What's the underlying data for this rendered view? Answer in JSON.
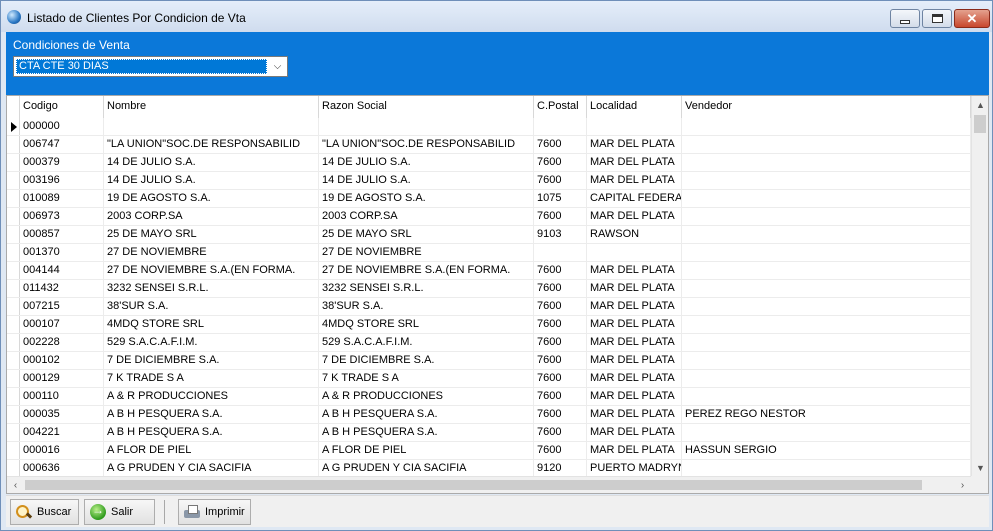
{
  "window": {
    "title": "Listado de Clientes Por Condicion de Vta"
  },
  "filter": {
    "label": "Condiciones de Venta",
    "selected": "CTA CTE 30 DIAS"
  },
  "grid": {
    "columns": [
      "Codigo",
      "Nombre",
      "Razon Social",
      "C.Postal",
      "Localidad",
      "Vendedor"
    ],
    "rows": [
      [
        "000000",
        "",
        "",
        "",
        "",
        ""
      ],
      [
        "006747",
        "\"LA UNION\"SOC.DE RESPONSABILID",
        "\"LA UNION\"SOC.DE RESPONSABILID",
        "7600",
        "MAR DEL PLATA",
        ""
      ],
      [
        "000379",
        "14 DE JULIO S.A.",
        "14 DE JULIO S.A.",
        "7600",
        "MAR DEL PLATA",
        ""
      ],
      [
        "003196",
        "14 DE JULIO S.A.",
        "14 DE JULIO S.A.",
        "7600",
        "MAR DEL PLATA",
        ""
      ],
      [
        "010089",
        "19 DE AGOSTO S.A.",
        "19 DE AGOSTO S.A.",
        "1075",
        "CAPITAL FEDERA",
        ""
      ],
      [
        "006973",
        "2003 CORP.SA",
        "2003 CORP.SA",
        "7600",
        "MAR DEL PLATA",
        ""
      ],
      [
        "000857",
        "25 DE MAYO SRL",
        "25 DE MAYO SRL",
        "9103",
        "RAWSON",
        ""
      ],
      [
        "001370",
        "27 DE NOVIEMBRE",
        "27 DE NOVIEMBRE",
        "",
        "",
        ""
      ],
      [
        "004144",
        "27 DE NOVIEMBRE S.A.(EN FORMA.",
        "27 DE NOVIEMBRE S.A.(EN FORMA.",
        "7600",
        "MAR DEL PLATA",
        ""
      ],
      [
        "011432",
        "3232 SENSEI S.R.L.",
        "3232 SENSEI S.R.L.",
        "7600",
        "MAR DEL PLATA",
        ""
      ],
      [
        "007215",
        "38'SUR S.A.",
        "38'SUR S.A.",
        "7600",
        "MAR DEL PLATA",
        ""
      ],
      [
        "000107",
        "4MDQ STORE SRL",
        "4MDQ STORE SRL",
        "7600",
        "MAR DEL PLATA",
        ""
      ],
      [
        "002228",
        "529  S.A.C.A.F.I.M.",
        "529  S.A.C.A.F.I.M.",
        "7600",
        "MAR DEL PLATA",
        ""
      ],
      [
        "000102",
        "7 DE DICIEMBRE S.A.",
        "7 DE DICIEMBRE S.A.",
        "7600",
        "MAR DEL PLATA",
        ""
      ],
      [
        "000129",
        "7 K TRADE S A",
        "7 K TRADE S A",
        "7600",
        "MAR DEL PLATA",
        ""
      ],
      [
        "000110",
        "A & R PRODUCCIONES",
        "A & R PRODUCCIONES",
        "7600",
        "MAR DEL PLATA",
        ""
      ],
      [
        "000035",
        "A B H PESQUERA S.A.",
        "A B H PESQUERA S.A.",
        "7600",
        "MAR DEL PLATA",
        "PEREZ REGO NESTOR"
      ],
      [
        "004221",
        "A B H PESQUERA S.A.",
        "A B H PESQUERA S.A.",
        "7600",
        "MAR DEL PLATA",
        ""
      ],
      [
        "000016",
        "A FLOR DE PIEL",
        "A FLOR DE PIEL",
        "7600",
        "MAR DEL PLATA",
        "HASSUN SERGIO"
      ],
      [
        "000636",
        "A G PRUDEN Y CIA SACIFIA",
        "A G PRUDEN Y CIA SACIFIA",
        "9120",
        "PUERTO MADRYN",
        ""
      ]
    ]
  },
  "toolbar": {
    "buscar": "Buscar",
    "salir": "Salir",
    "imprimir": "Imprimir"
  },
  "icons": {
    "app": "globe-icon",
    "buscar": "magnifier-icon",
    "salir": "exit-arrow-icon",
    "imprimir": "printer-icon"
  },
  "colors": {
    "panel": "#0b78d9",
    "selection": "#0078d7",
    "close": "#c8472d"
  }
}
